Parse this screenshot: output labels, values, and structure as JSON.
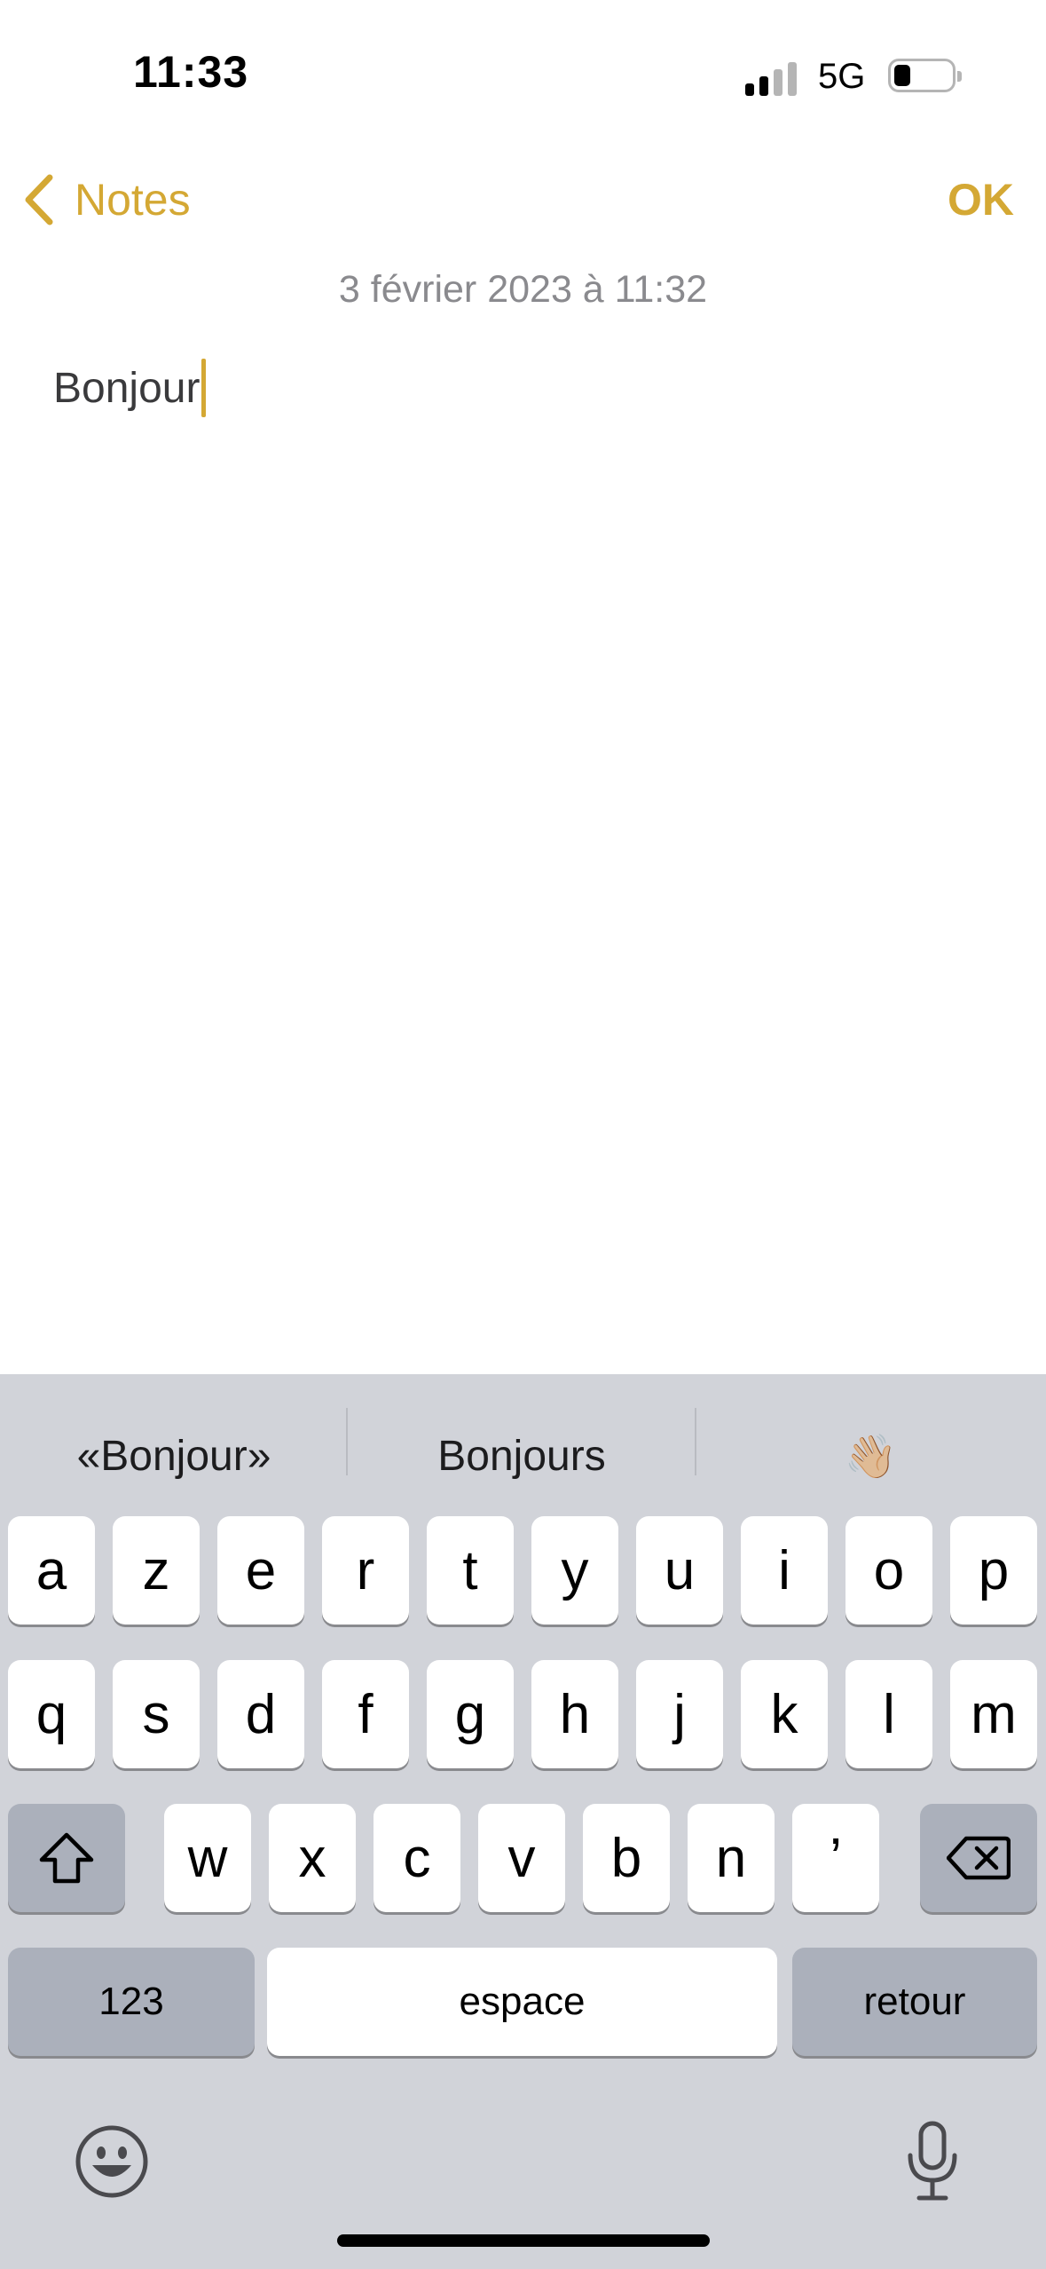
{
  "status_bar": {
    "time": "11:33",
    "network": "5G",
    "signal_bars_active": 2,
    "signal_bars_total": 4,
    "battery_level": 0.15
  },
  "nav": {
    "back_label": "Notes",
    "done_label": "OK"
  },
  "note": {
    "date": "3 février 2023 à 11:32",
    "text": "Bonjour"
  },
  "keyboard": {
    "suggestions": [
      "«Bonjour»",
      "Bonjours",
      "👋🏼"
    ],
    "row1": [
      "a",
      "z",
      "e",
      "r",
      "t",
      "y",
      "u",
      "i",
      "o",
      "p"
    ],
    "row2": [
      "q",
      "s",
      "d",
      "f",
      "g",
      "h",
      "j",
      "k",
      "l",
      "m"
    ],
    "row3": [
      "w",
      "x",
      "c",
      "v",
      "b",
      "n",
      "’"
    ],
    "numbers_label": "123",
    "space_label": "espace",
    "return_label": "retour"
  },
  "colors": {
    "accent": "#d4a834",
    "keyboard_bg": "#d1d3d9",
    "dark_key": "#abb0bb"
  }
}
